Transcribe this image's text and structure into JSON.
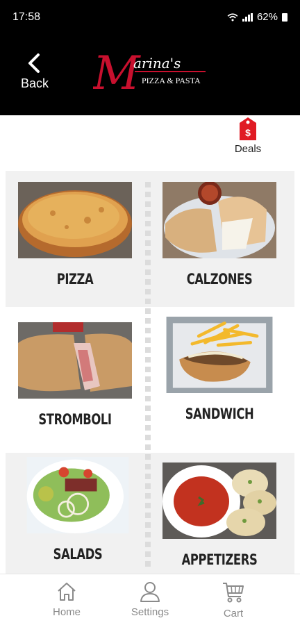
{
  "status_bar": {
    "time": "17:58",
    "battery": "62%"
  },
  "header": {
    "back_label": "Back",
    "logo": {
      "script": "Marina's",
      "subtitle": "PIZZA & PASTA"
    }
  },
  "deals": {
    "label": "Deals",
    "icon": "price-tag-icon",
    "color": "#e01b24"
  },
  "categories": [
    {
      "label": "PIZZA"
    },
    {
      "label": "CALZONES"
    },
    {
      "label": "STROMBOLI"
    },
    {
      "label": "SANDWICH"
    },
    {
      "label": "SALADS"
    },
    {
      "label": "APPETIZERS"
    }
  ],
  "tab_bar": {
    "items": [
      {
        "label": "Home",
        "icon": "home-icon"
      },
      {
        "label": "Settings",
        "icon": "user-icon"
      },
      {
        "label": "Cart",
        "icon": "cart-icon"
      }
    ]
  },
  "colors": {
    "brand_red": "#c8102e",
    "header_bg": "#000000",
    "accent": "#e01b24"
  }
}
